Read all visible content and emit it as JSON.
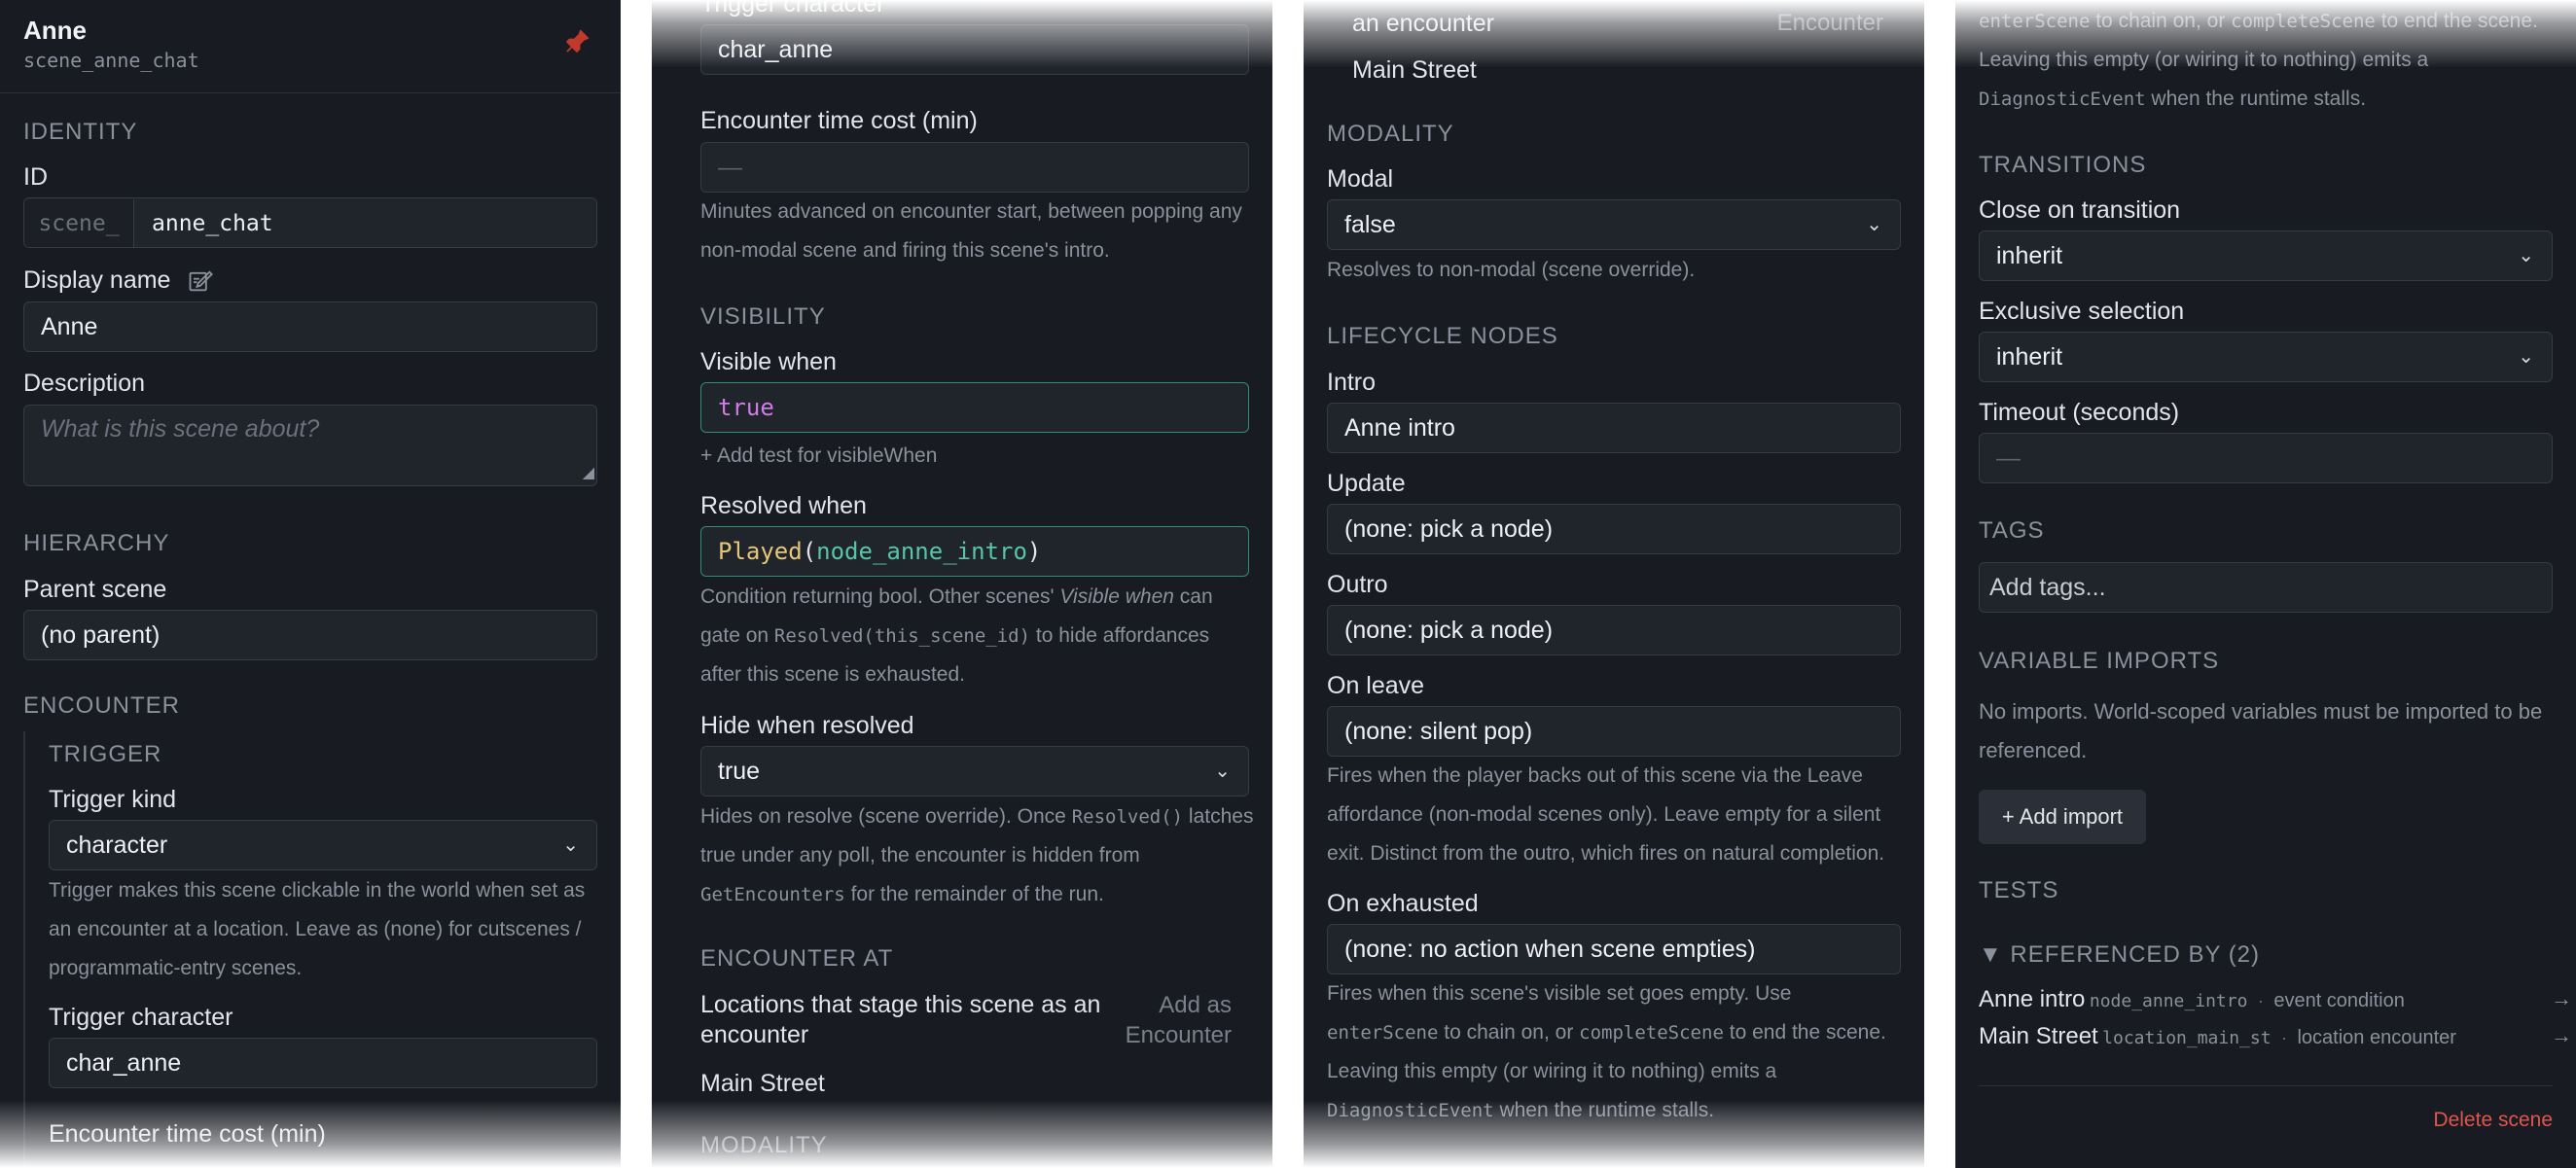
{
  "header": {
    "title": "Anne",
    "subtitle": "scene_anne_chat"
  },
  "identity": {
    "section": "IDENTITY",
    "id_label": "ID",
    "id_prefix": "scene_",
    "id_value": "anne_chat",
    "display_name_label": "Display name",
    "display_name_value": "Anne",
    "description_label": "Description",
    "description_placeholder": "What is this scene about?"
  },
  "hierarchy": {
    "section": "HIERARCHY",
    "parent_label": "Parent scene",
    "parent_value": "(no parent)"
  },
  "encounter": {
    "section": "ENCOUNTER",
    "trigger_section": "TRIGGER",
    "trigger_kind_label": "Trigger kind",
    "trigger_kind_value": "character",
    "trigger_help": "Trigger makes this scene clickable in the world when set as an encounter at a location. Leave as (none) for cutscenes / programmatic-entry scenes.",
    "trigger_character_label": "Trigger character",
    "trigger_character_value": "char_anne",
    "time_cost_label": "Encounter time cost (min)",
    "time_cost_value": "—",
    "time_cost_help": "Minutes advanced on encounter start, between popping any non-modal scene and firing this scene's intro."
  },
  "visibility": {
    "section": "VISIBILITY",
    "visible_when_label": "Visible when",
    "visible_when_value": "true",
    "add_test_link": "+ Add test for visibleWhen",
    "resolved_when_label": "Resolved when",
    "resolved_fn": "Played",
    "resolved_open": "(",
    "resolved_arg": "node_anne_intro",
    "resolved_close": ")",
    "resolved_help_1": "Condition returning bool. Other scenes'",
    "resolved_help_italic": "Visible when",
    "resolved_help_2": "can gate on",
    "resolved_help_code": "Resolved(this_scene_id)",
    "resolved_help_3": "to hide affordances after this scene is exhausted.",
    "hide_label": "Hide when resolved",
    "hide_value": "true",
    "hide_help_1": "Hides on resolve (scene override). Once",
    "hide_help_code1": "Resolved()",
    "hide_help_2": "latches true under any poll, the encounter is hidden from",
    "hide_help_code2": "GetEncounters",
    "hide_help_3": "for the remainder of the run."
  },
  "encounter_at": {
    "section": "ENCOUNTER AT",
    "description": "Locations that stage this scene as an encounter",
    "add_button": "Add as Encounter",
    "locations": [
      "Main Street"
    ]
  },
  "modality": {
    "section": "MODALITY",
    "modal_label": "Modal",
    "modal_value": "false",
    "modal_help": "Resolves to non-modal (scene override)."
  },
  "lifecycle": {
    "section": "LIFECYCLE NODES",
    "intro_label": "Intro",
    "intro_value": "Anne intro",
    "update_label": "Update",
    "update_value": "(none: pick a node)",
    "outro_label": "Outro",
    "outro_value": "(none: pick a node)",
    "on_leave_label": "On leave",
    "on_leave_value": "(none: silent pop)",
    "on_leave_help": "Fires when the player backs out of this scene via the Leave affordance (non-modal scenes only). Leave empty for a silent exit. Distinct from the outro, which fires on natural completion.",
    "on_exhausted_label": "On exhausted",
    "on_exhausted_value": "(none: no action when scene empties)",
    "on_exhausted_help_1": "Fires when this scene's visible set goes empty. Use",
    "on_exhausted_code1": "enterScene",
    "on_exhausted_help_2": "to chain on, or",
    "on_exhausted_code2": "completeScene",
    "on_exhausted_help_3": "to end the scene. Leaving this empty (or wiring it to nothing) emits a",
    "on_exhausted_code3": "DiagnosticEvent",
    "on_exhausted_help_4": "when the runtime stalls."
  },
  "transitions": {
    "section": "TRANSITIONS",
    "close_label": "Close on transition",
    "close_value": "inherit",
    "exclusive_label": "Exclusive selection",
    "exclusive_value": "inherit",
    "timeout_label": "Timeout (seconds)",
    "timeout_value": "—"
  },
  "tags": {
    "section": "TAGS",
    "placeholder": "Add tags..."
  },
  "imports": {
    "section": "VARIABLE IMPORTS",
    "empty_text": "No imports. World-scoped variables must be imported to be referenced.",
    "add_button": "+ Add import"
  },
  "tests": {
    "section": "TESTS"
  },
  "referenced_by": {
    "header": "▼ REFERENCED BY (2)",
    "items": [
      {
        "name": "Anne intro",
        "id": "node_anne_intro",
        "sep": "·",
        "kind": "event condition",
        "arrow": "→"
      },
      {
        "name": "Main Street",
        "id": "location_main_st",
        "sep": "·",
        "kind": "location encounter",
        "arrow": "→"
      }
    ]
  },
  "delete_button": "Delete scene",
  "colors": {
    "panel_bg": "#181b21",
    "field_bg": "#20242b",
    "field_border": "#353a44",
    "accent_green": "#2f8f72",
    "pin_red": "#c0392b",
    "delete_red": "#e0554e",
    "keyword_purple": "#d17be6",
    "function_yellow": "#e6c77a"
  }
}
